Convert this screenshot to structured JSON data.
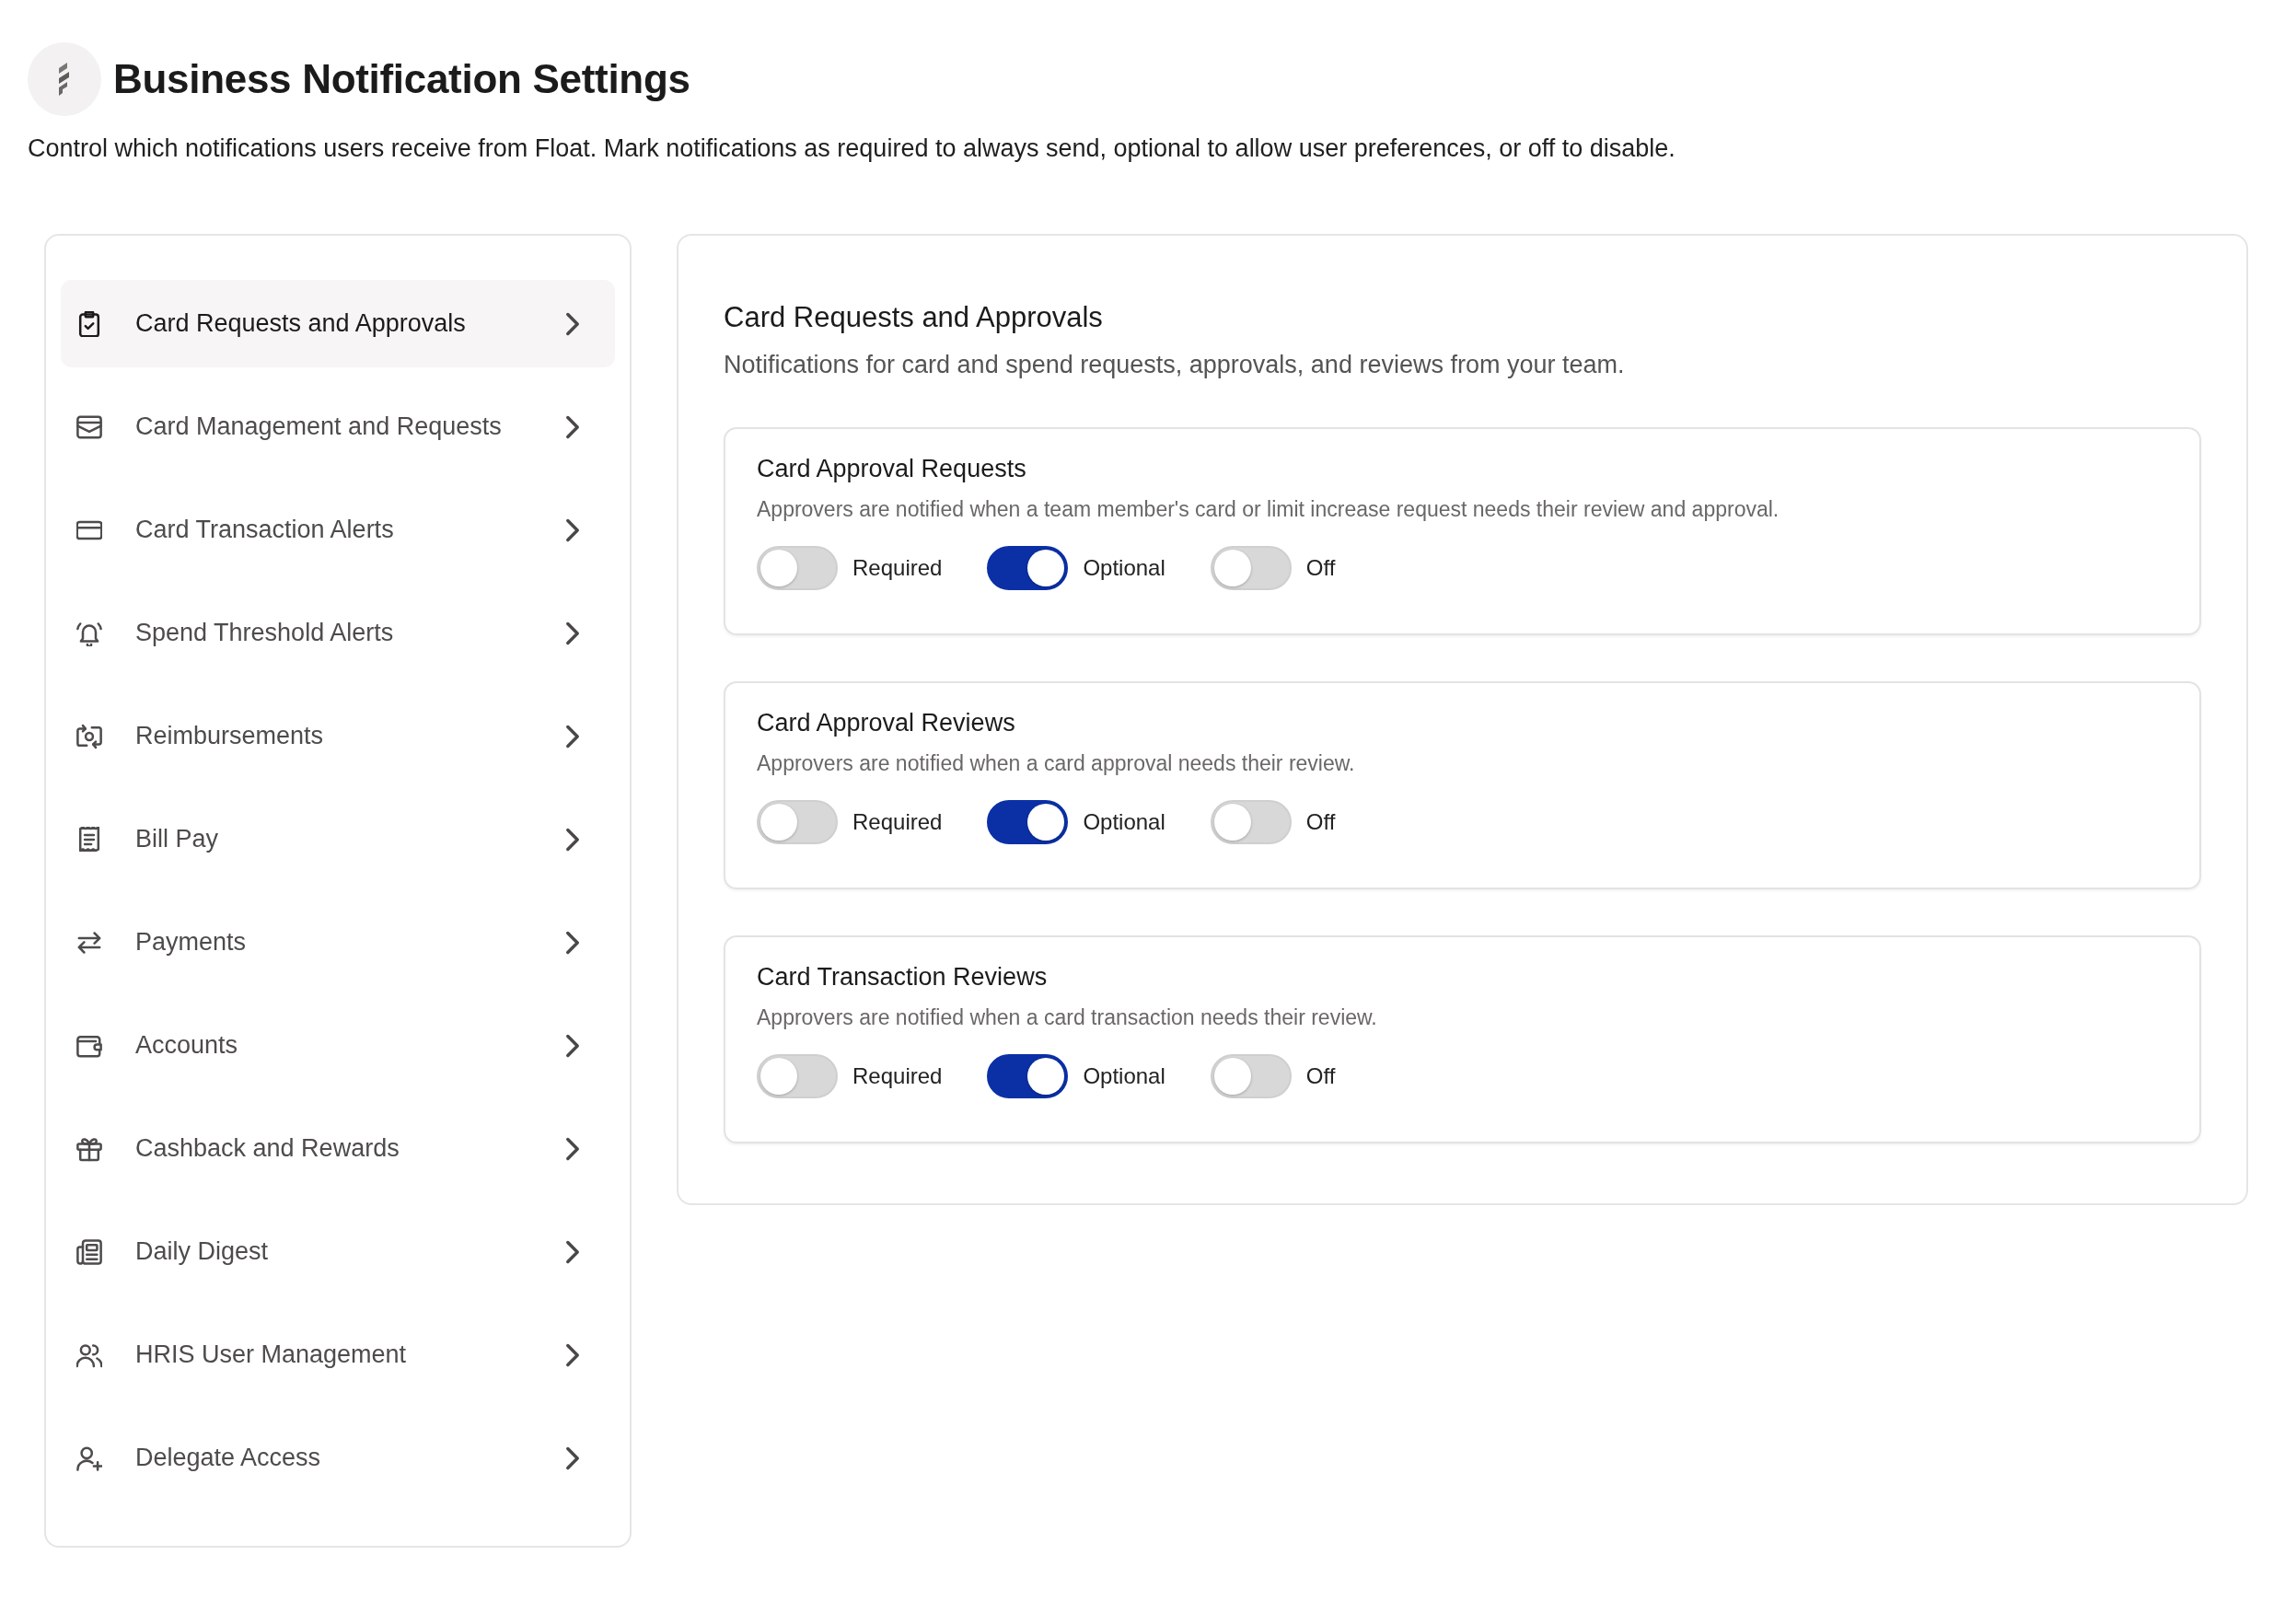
{
  "header": {
    "title": "Business Notification Settings",
    "description": "Control which notifications users receive from Float. Mark notifications as required to always send, optional to allow user preferences, or off to disable."
  },
  "sidebar": {
    "items": [
      {
        "label": "Card Requests and Approvals",
        "selected": true
      },
      {
        "label": "Card Management and Requests",
        "selected": false
      },
      {
        "label": "Card Transaction Alerts",
        "selected": false
      },
      {
        "label": "Spend Threshold Alerts",
        "selected": false
      },
      {
        "label": "Reimbursements",
        "selected": false
      },
      {
        "label": "Bill Pay",
        "selected": false
      },
      {
        "label": "Payments",
        "selected": false
      },
      {
        "label": "Accounts",
        "selected": false
      },
      {
        "label": "Cashback and Rewards",
        "selected": false
      },
      {
        "label": "Daily Digest",
        "selected": false
      },
      {
        "label": "HRIS User Management",
        "selected": false
      },
      {
        "label": "Delegate Access",
        "selected": false
      }
    ]
  },
  "section": {
    "title": "Card Requests and Approvals",
    "description": "Notifications for card and spend requests, approvals, and reviews from your team.",
    "notifications": [
      {
        "title": "Card Approval Requests",
        "description": "Approvers are notified when a team member's card or limit increase request needs their review and approval.",
        "options": [
          {
            "label": "Required",
            "on": false
          },
          {
            "label": "Optional",
            "on": true
          },
          {
            "label": "Off",
            "on": false
          }
        ]
      },
      {
        "title": "Card Approval Reviews",
        "description": "Approvers are notified when a card approval needs their review.",
        "options": [
          {
            "label": "Required",
            "on": false
          },
          {
            "label": "Optional",
            "on": true
          },
          {
            "label": "Off",
            "on": false
          }
        ]
      },
      {
        "title": "Card Transaction Reviews",
        "description": "Approvers are notified when a card transaction needs their review.",
        "options": [
          {
            "label": "Required",
            "on": false
          },
          {
            "label": "Optional",
            "on": true
          },
          {
            "label": "Off",
            "on": false
          }
        ]
      }
    ]
  }
}
